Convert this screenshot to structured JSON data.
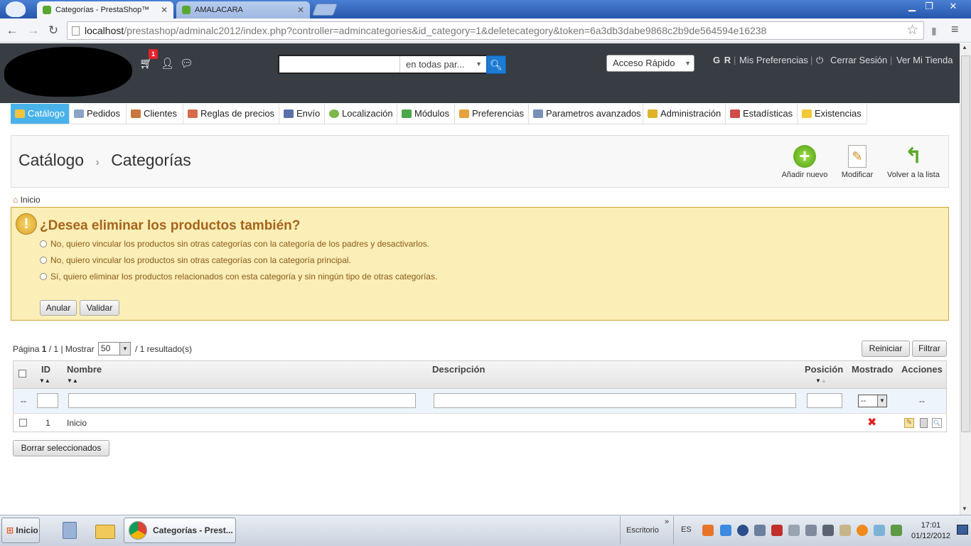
{
  "browser": {
    "tabs": [
      {
        "title": "Categorías - PrestaShop™"
      },
      {
        "title": "AMALACARA"
      }
    ],
    "url_host": "localhost",
    "url_path": "/prestashop/adminalc2012/index.php?controller=admincategories&id_category=1&deletecategory&token=6a3db3dabe9868c2b9de564594e16238"
  },
  "header": {
    "cart_badge": "1",
    "search_scope": "en todas par...",
    "quick_access": "Acceso Rápido",
    "user_initials": "G R",
    "preferences": "Mis Preferencias",
    "logout": "Cerrar Sesión",
    "view_store": "Ver Mi Tienda"
  },
  "menu": [
    {
      "label": "Catálogo",
      "color": "#f3c33d"
    },
    {
      "label": "Pedidos",
      "color": "#8ba4c8"
    },
    {
      "label": "Clientes",
      "color": "#c9773e"
    },
    {
      "label": "Reglas de precios",
      "color": "#d66b4c"
    },
    {
      "label": "Envío",
      "color": "#5b6fa8"
    },
    {
      "label": "Localización",
      "color": "#7ab648"
    },
    {
      "label": "Módulos",
      "color": "#4ca64a"
    },
    {
      "label": "Preferencias",
      "color": "#e5a23d"
    },
    {
      "label": "Parametros avanzados",
      "color": "#7a8fb8"
    },
    {
      "label": "Administración",
      "color": "#e0b22a"
    },
    {
      "label": "Estadísticas",
      "color": "#d04a4a"
    },
    {
      "label": "Existencias",
      "color": "#f2c739"
    }
  ],
  "page": {
    "title_section": "Catálogo",
    "separator": "›",
    "title_page": "Categorías",
    "actions": {
      "add": "Añadir nuevo",
      "edit": "Modificar",
      "back": "Volver a la lista"
    },
    "breadcrumb": "Inicio"
  },
  "warning": {
    "title": "¿Desea eliminar los productos también?",
    "options": [
      "No, quiero vincular los productos sin otras categorías con la categoría de los padres y desactivarlos.",
      "No, quiero vincular los productos sin otras categorías con la categoría principal.",
      "Sí, quiero eliminar los productos relacionados con esta categoría y sin ningún tipo de otras categorías."
    ],
    "cancel": "Anular",
    "validate": "Validar"
  },
  "list": {
    "page_label": "Página",
    "page_current": "1",
    "page_total": "/ 1",
    "show_label": "| Mostrar",
    "per_page": "50",
    "results": "/ 1 resultado(s)",
    "reset": "Reiniciar",
    "filter": "Filtrar",
    "columns": {
      "id": "ID",
      "name": "Nombre",
      "description": "Descripción",
      "position": "Posición",
      "displayed": "Mostrado",
      "actions": "Acciones"
    },
    "filter_placeholder_dash": "--",
    "filter_select": "--",
    "rows": [
      {
        "id": "1",
        "name": "Inicio",
        "description": "",
        "displayed": "✖"
      }
    ],
    "bulk_delete": "Borrar seleccionados"
  },
  "taskbar": {
    "start": "Inicio",
    "active_app": "Categorías - Prest...",
    "desktop": "Escritorio",
    "chevron": "»",
    "lang": "ES",
    "time": "17:01",
    "date": "01/12/2012"
  }
}
